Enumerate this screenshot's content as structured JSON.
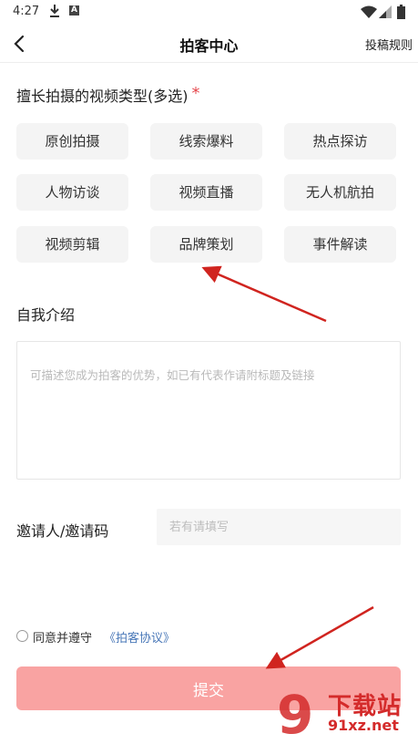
{
  "status_bar": {
    "time": "4:27",
    "a_badge": "A"
  },
  "nav": {
    "title": "拍客中心",
    "rules": "投稿规则"
  },
  "video_types": {
    "title": "擅长拍摄的视频类型(多选)",
    "required_mark": "*",
    "tags": [
      "原创拍摄",
      "线索爆料",
      "热点探访",
      "人物访谈",
      "视频直播",
      "无人机航拍",
      "视频剪辑",
      "品牌策划",
      "事件解读"
    ]
  },
  "intro": {
    "title": "自我介绍",
    "placeholder": "可描述您成为拍客的优势，如已有代表作请附标题及链接"
  },
  "invite": {
    "label": "邀请人/邀请码",
    "placeholder": "若有请填写"
  },
  "agreement": {
    "text": "同意并遵守",
    "link": "《拍客协议》"
  },
  "submit": {
    "label": "提交"
  },
  "colors": {
    "required": "#e5484d",
    "submit_bg": "#f9a3a2",
    "link": "#4a78b8",
    "arrow": "#d0241f"
  },
  "watermark": {
    "logo_text": "下载站",
    "url": "91xz.net",
    "logo_mark": "9"
  }
}
